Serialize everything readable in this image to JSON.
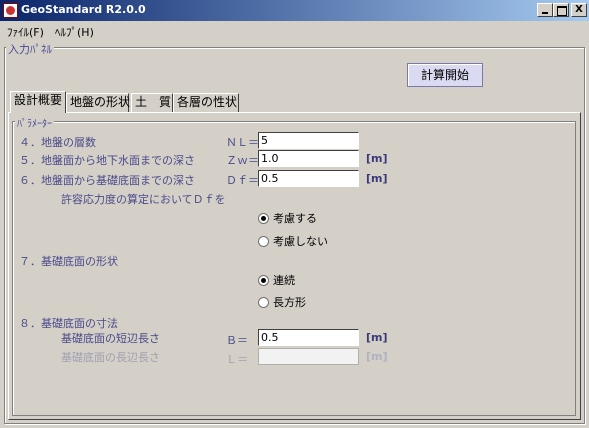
{
  "window": {
    "title": "GeoStandard R2.0.0",
    "min": "_",
    "max": "□",
    "close": "X"
  },
  "menu": [
    {
      "label": "ﾌｧｲﾙ(F)"
    },
    {
      "label": "ﾍﾙﾌﾟ(H)"
    }
  ],
  "input_panel": {
    "legend": "入力ﾊﾟﾈﾙ",
    "start_button": "計算開始"
  },
  "tabs": [
    {
      "label": "設計概要",
      "active": true
    },
    {
      "label": "地盤の形状",
      "active": false
    },
    {
      "label": "土　質",
      "active": false
    },
    {
      "label": "各層の性状",
      "active": false
    }
  ],
  "params": {
    "legend": "ﾊﾟﾗﾒｰﾀｰ",
    "item4": {
      "label": "４．地盤の層数",
      "symbol": "ＮＬ＝",
      "value": "5"
    },
    "item5": {
      "label": "５．地盤面から地下水面までの深さ",
      "symbol": "Ｚｗ＝",
      "value": "1.0",
      "unit": "[m]"
    },
    "item6": {
      "label": "６．地盤面から基礎底面までの深さ",
      "symbol": "Ｄｆ＝",
      "value": "0.5",
      "unit": "[m]"
    },
    "item6_sub": "許容応力度の算定においてＤｆを",
    "df_options": [
      {
        "label": "考慮する",
        "selected": true
      },
      {
        "label": "考慮しない",
        "selected": false
      }
    ],
    "item7": {
      "label": "７．基礎底面の形状"
    },
    "shape_options": [
      {
        "label": "連続",
        "selected": true
      },
      {
        "label": "長方形",
        "selected": false
      }
    ],
    "item8": {
      "label": "８．基礎底面の寸法"
    },
    "short_side": {
      "label": "基礎底面の短辺長さ",
      "symbol": "Ｂ＝",
      "value": "0.5",
      "unit": "[m]"
    },
    "long_side": {
      "label": "基礎底面の長辺長さ",
      "symbol": "Ｌ＝",
      "value": "",
      "unit": "[m]"
    }
  }
}
